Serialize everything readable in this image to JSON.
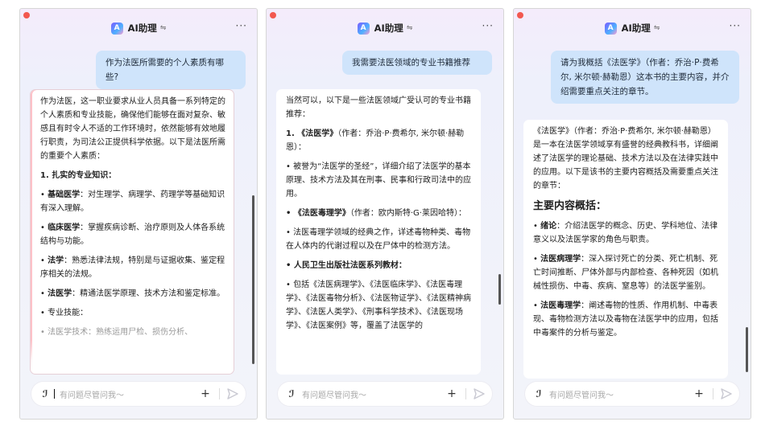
{
  "app": {
    "title": "AI助理",
    "title_caret": "⇋",
    "more": "···",
    "icon_glyph": "A"
  },
  "input": {
    "placeholder": "有问题尽管问我～",
    "plus": "+"
  },
  "panels": [
    {
      "question": "作为法医所需要的个人素质有哪些?",
      "answer": {
        "intro": "作为法医，这一职业要求从业人员具备一系列特定的个人素质和专业技能，确保他们能够在面对复杂、敏感且有时令人不适的工作环境时，依然能够有效地履行职责，为司法公正提供科学依据。以下是法医所需的重要个人素质：",
        "section": "1. 扎实的专业知识：",
        "items": [
          {
            "label": "基础医学",
            "text": "：对生理学、病理学、药理学等基础知识有深入理解。"
          },
          {
            "label": "临床医学",
            "text": "：掌握疾病诊断、治疗原则及人体各系统结构与功能。"
          },
          {
            "label": "法学",
            "text": "：熟悉法律法规，特别是与证据收集、鉴定程序相关的法规。"
          },
          {
            "label": "法医学",
            "text": "：精通法医学原理、技术方法和鉴定标准。"
          }
        ],
        "tail1": "• 专业技能：",
        "tail2": "• 法医学技术：熟练运用尸检、损伤分析、"
      }
    },
    {
      "question": "我需要法医领域的专业书籍推荐",
      "answer": {
        "intro": "当然可以，以下是一些法医领域广受认可的专业书籍推荐：",
        "book1_title": "1. 《法医学》",
        "book1_author": "（作者：乔治·P·费希尔, 米尔顿·赫勒恩）：",
        "book1_desc": "• 被誉为“法医学的圣经”，详细介绍了法医学的基本原理、技术方法及其在刑事、民事和行政司法中的应用。",
        "book2_title": "• 《法医毒理学》",
        "book2_author": "（作者：欧内斯特·G·莱因哈特）：",
        "book2_desc": "• 法医毒理学领域的经典之作，详述毒物种类、毒物在人体内的代谢过程以及在尸体中的检测方法。",
        "book3_title": "• 人民卫生出版社法医系列教材：",
        "book3_desc": "• 包括《法医病理学》、《法医临床学》、《法医毒理学》、《法医毒物分析》、《法医物证学》、《法医精神病学》、《法医人类学》、《刑事科学技术》、《法医现场学》、《法医案例》等，覆盖了法医学的"
      }
    },
    {
      "question": "请为我概括《法医学》（作者：乔治·P·费希尔, 米尔顿·赫勒恩）这本书的主要内容，并介绍需要重点关注的章节。",
      "answer": {
        "intro": "《法医学》（作者：乔治·P·费希尔, 米尔顿·赫勒恩）是一本在法医学领域享有盛誉的经典教科书，详细阐述了法医学的理论基础、技术方法以及在法律实践中的应用。以下是该书的主要内容概括及需要重点关注的章节：",
        "heading": "主要内容概括：",
        "items": [
          {
            "label": "绪论",
            "text": "：介绍法医学的概念、历史、学科地位、法律意义以及法医学家的角色与职责。"
          },
          {
            "label": "法医病理学",
            "text": "：深入探讨死亡的分类、死亡机制、死亡时间推断、尸体外部与内部检查、各种死因（如机械性损伤、中毒、疾病、窒息等）的法医学鉴别。"
          },
          {
            "label": "法医毒理学",
            "text": "：阐述毒物的性质、作用机制、中毒表现、毒物检测方法以及毒物在法医学中的应用，包括中毒案件的分析与鉴定。"
          }
        ]
      }
    }
  ]
}
